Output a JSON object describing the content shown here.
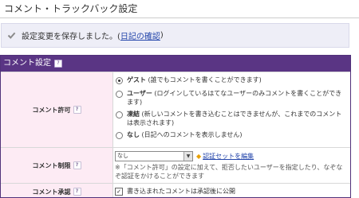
{
  "page": {
    "title": "コメント・トラックバック設定"
  },
  "notice": {
    "text": "設定変更を保存しました。(",
    "link": "日記の確認",
    "suffix": ")"
  },
  "panel": {
    "title": "コメント設定",
    "help_glyph": "?",
    "rows": {
      "permission": {
        "label": "コメント許可",
        "options": [
          {
            "name": "ゲスト",
            "desc": "(誰でもコメントを書くことができます)",
            "selected": true
          },
          {
            "name": "ユーザー",
            "desc": "(ログインしているはてなユーザーのみコメントを書くことができます)",
            "selected": false
          },
          {
            "name": "凍結",
            "desc": "(新しいコメントを書き込むことはできませんが、これまでのコメントは表示されます)",
            "selected": false
          },
          {
            "name": "なし",
            "desc": "(日記へのコメントを表示しません)",
            "selected": false
          }
        ]
      },
      "restriction": {
        "label": "コメント制限",
        "select_value": "なし",
        "marker": "◆",
        "edit_link": "認証セットを編集",
        "note": "※「コメント許可」の設定に加えて、拒否したいユーザーを指定したり、なぞなぞ認証をかけることができます"
      },
      "approval": {
        "label": "コメント承認",
        "checkbox_checked": true,
        "checkbox_text": "書き込まれたコメントは承認後に公開"
      }
    }
  },
  "colors": {
    "panel_header": "#5a3584",
    "label_bg": "#fdebf4",
    "notice_bg": "#eeeef7",
    "link": "#2244aa"
  },
  "icons": [
    "check-icon",
    "help-icon",
    "dropdown-arrow-icon"
  ]
}
